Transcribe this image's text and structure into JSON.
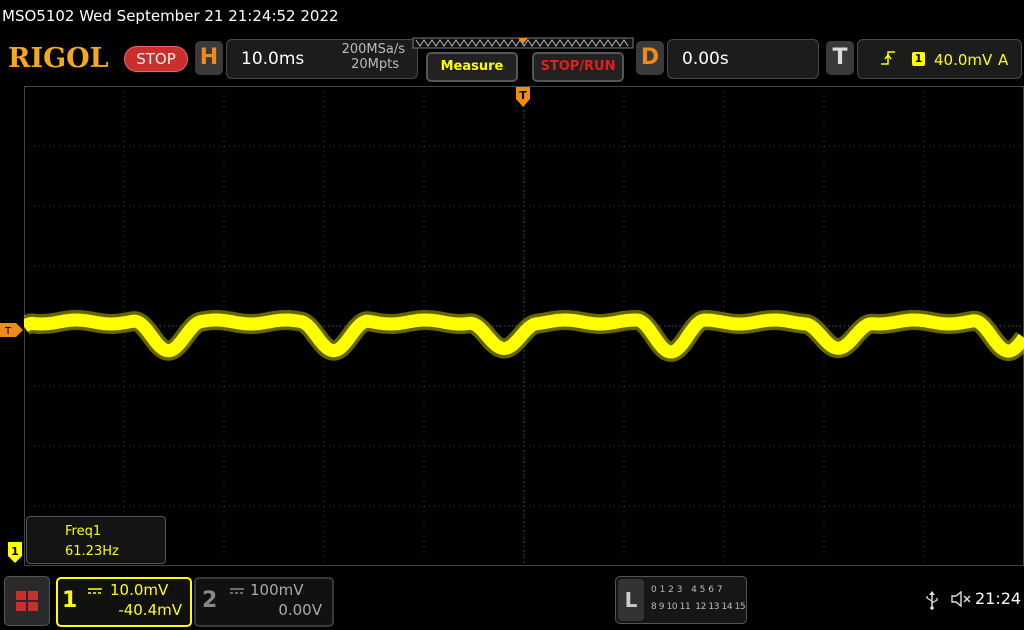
{
  "title": "MSO5102  Wed September 21 21:24:52 2022",
  "toolbar": {
    "logo": "RIGOL",
    "status": "STOP",
    "horizontal": {
      "letter": "H",
      "timebase": "10.0ms",
      "sample_rate": "200MSa/s",
      "memory_depth": "20Mpts"
    },
    "measure_label": "Measure",
    "stoprun_label": "STOP/RUN",
    "delay": {
      "letter": "D",
      "value": "0.00s"
    },
    "trigger": {
      "letter": "T",
      "channel": "1",
      "level": "40.0mV",
      "mode": "A"
    }
  },
  "screen": {
    "trigger_marker": "T",
    "ground_marker": "1",
    "waveform_color": "#ffff00"
  },
  "measurement": {
    "label": "Freq1",
    "value": "61.23Hz"
  },
  "channels": [
    {
      "number": "1",
      "scale": "10.0mV",
      "offset": "-40.4mV",
      "color": "#ffff00",
      "active": true
    },
    {
      "number": "2",
      "scale": "100mV",
      "offset": "0.00V",
      "color": "#888888",
      "active": false
    }
  ],
  "logic": {
    "letter": "L",
    "row1": "0 1 2 3   4 5 6 7",
    "row2": "8 9 10 11  12 13 14 15"
  },
  "status_bar": {
    "time": "21:24"
  },
  "colors": {
    "accent": "#f08a1a",
    "stop": "#c9302c",
    "channel1": "#ffff00"
  },
  "icons": [
    "menu-grid-icon",
    "usb-icon",
    "speaker-muted-icon"
  ]
}
